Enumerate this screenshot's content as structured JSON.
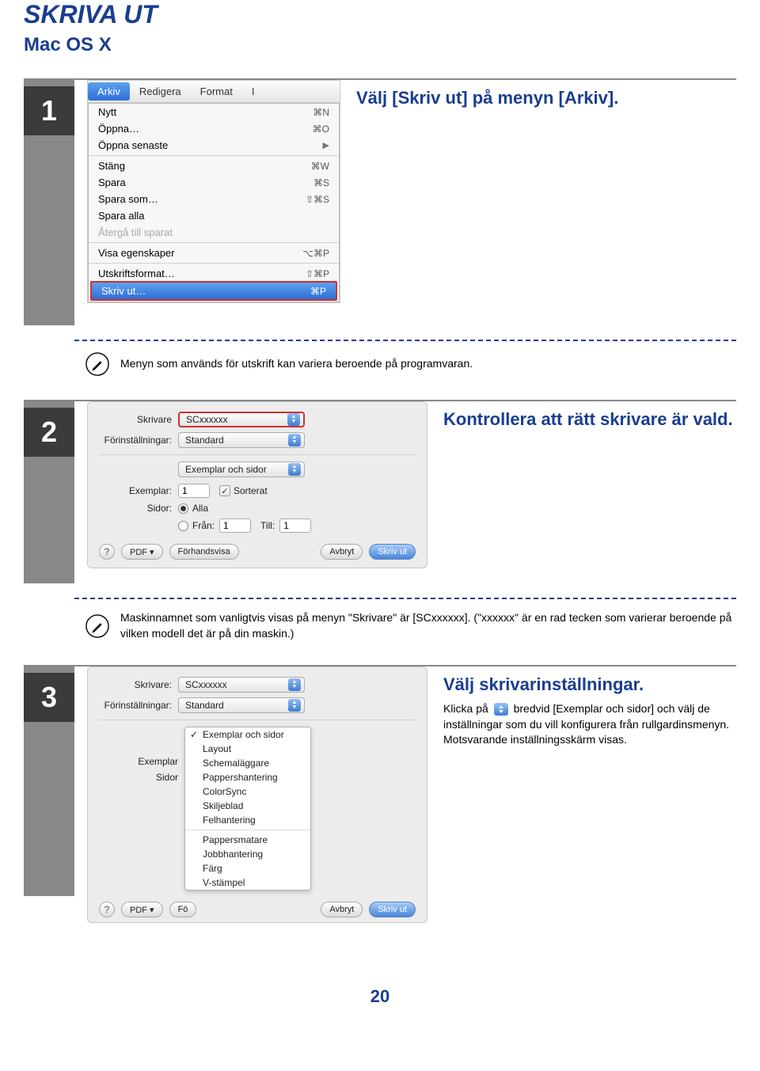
{
  "title": "SKRIVA UT",
  "subtitle": "Mac OS X",
  "page_number": "20",
  "steps": [
    {
      "number": "1",
      "heading": "Välj [Skriv ut] på menyn [Arkiv].",
      "note": "Menyn som används för utskrift kan variera beroende på programvaran."
    },
    {
      "number": "2",
      "heading": "Kontrollera att rätt skrivare är vald.",
      "note": "Maskinnamnet som vanligtvis visas på menyn \"Skrivare\" är [SCxxxxxx]. (\"xxxxxx\" är en rad tecken som varierar beroende på vilken modell det är på din maskin.)"
    },
    {
      "number": "3",
      "heading": "Välj skrivarinställningar.",
      "body_before": "Klicka på ",
      "body_after": " bredvid [Exemplar och sidor] och välj de inställningar som du vill konfigurera från rullgardinsmenyn. Motsvarande inställningsskärm visas."
    }
  ],
  "menu": {
    "tabs": [
      "Arkiv",
      "Redigera",
      "Format",
      "I"
    ],
    "items": [
      {
        "label": "Nytt",
        "shortcut": "⌘N"
      },
      {
        "label": "Öppna…",
        "shortcut": "⌘O"
      },
      {
        "label": "Öppna senaste",
        "submenu": true
      },
      {
        "sep": true
      },
      {
        "label": "Stäng",
        "shortcut": "⌘W"
      },
      {
        "label": "Spara",
        "shortcut": "⌘S"
      },
      {
        "label": "Spara som…",
        "shortcut": "⇧⌘S"
      },
      {
        "label": "Spara alla"
      },
      {
        "label": "Återgå till sparat",
        "disabled": true
      },
      {
        "sep": true
      },
      {
        "label": "Visa egenskaper",
        "shortcut": "⌥⌘P"
      },
      {
        "sep": true
      },
      {
        "label": "Utskriftsformat…",
        "shortcut": "⇧⌘P"
      },
      {
        "label": "Skriv ut…",
        "shortcut": "⌘P",
        "selected": true
      }
    ]
  },
  "dialog": {
    "printer_label": "Skrivare",
    "printer_value": "SCxxxxxx",
    "presets_label": "Förinställningar:",
    "presets_value": "Standard",
    "section_label": "Exemplar och sidor",
    "copies_label": "Exemplar:",
    "copies_value": "1",
    "collated_label": "Sorterat",
    "pages_label": "Sidor:",
    "pages_all": "Alla",
    "pages_from": "Från:",
    "pages_from_value": "1",
    "pages_to": "Till:",
    "pages_to_value": "1",
    "help": "?",
    "pdf": "PDF ▾",
    "preview": "Förhandsvisa",
    "cancel": "Avbryt",
    "print": "Skriv ut"
  },
  "dropdown": {
    "checked": "Exemplar och sidor",
    "items": [
      "Layout",
      "Schemaläggare",
      "Pappershantering",
      "ColorSync",
      "Skiljeblad",
      "Felhantering",
      "Pappersmatare",
      "Jobbhantering",
      "Färg",
      "V-stämpel"
    ]
  },
  "step3_dialog": {
    "printer_label": "Skrivare:",
    "presets_label": "Förinställningar:",
    "copies_abbr": "Exemplar",
    "pages_abbr": "Sidor",
    "fo": "Fö"
  }
}
